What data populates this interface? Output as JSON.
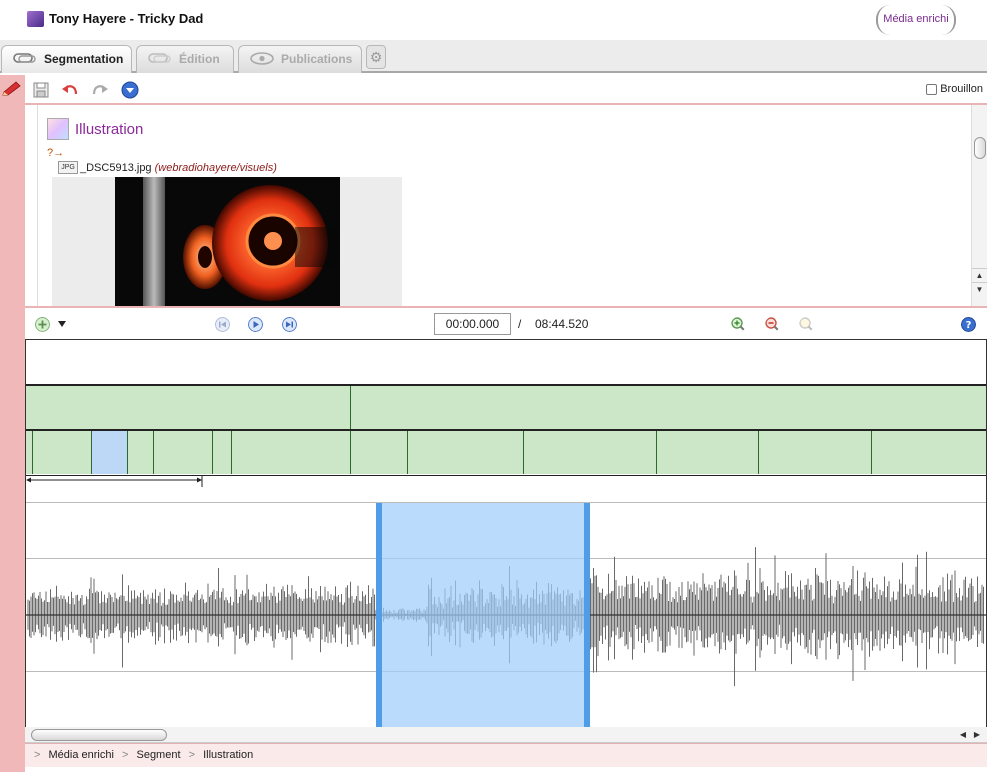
{
  "window": {
    "title": "Tony Hayere - Tricky Dad",
    "badge": "Média enrichi"
  },
  "tabs": [
    {
      "label": "Segmentation",
      "active": true
    },
    {
      "label": "Édition",
      "active": false
    },
    {
      "label": "Publications",
      "active": false
    }
  ],
  "toolbar": {
    "draft_label": "Brouillon",
    "draft_checked": false
  },
  "content": {
    "title": "Illustration",
    "marker": "?→",
    "file_type": "JPG",
    "file_name": "_DSC5913.jpg",
    "file_path": "(webradiohayere/visuels)"
  },
  "player": {
    "current_time": "00:00.000",
    "separator": "/",
    "duration": "08:44.520"
  },
  "breadcrumb": [
    "Média enrichi",
    "Segment",
    "Illustration"
  ],
  "colors": {
    "accent": "#8b2a99",
    "segment_fill": "#cce7c8",
    "selection": "#b8d8f8",
    "rail": "#f0b8b8"
  }
}
